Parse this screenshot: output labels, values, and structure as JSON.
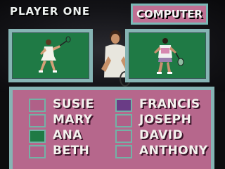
{
  "header": {
    "player_label": "PLAYER ONE",
    "opponent_label": "COMPUTER"
  },
  "player_one": {
    "selected": "ANA",
    "highlight_color": "#1f7a45"
  },
  "computer": {
    "selected": "FRANCIS",
    "highlight_color": "#6a3c86"
  },
  "roster": {
    "left_column": [
      "SUSIE",
      "MARY",
      "ANA",
      "BETH"
    ],
    "right_column": [
      "FRANCIS",
      "JOSEPH",
      "DAVID",
      "ANTHONY"
    ]
  },
  "colors": {
    "panel": "#b6678c",
    "frame": "#86b4b4",
    "court": "#1f7a45",
    "computer_label_bg": "#bf6f93"
  }
}
